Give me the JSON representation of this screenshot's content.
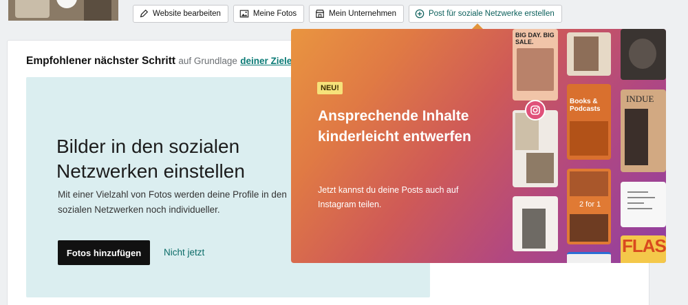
{
  "toolbar": {
    "buttons": [
      {
        "label": "Website bearbeiten",
        "icon": "pencil-icon"
      },
      {
        "label": "Meine Fotos",
        "icon": "image-icon"
      },
      {
        "label": "Mein Unternehmen",
        "icon": "storefront-icon"
      },
      {
        "label": "Post für soziale Netzwerke erstellen",
        "icon": "plus-circle-icon"
      }
    ]
  },
  "recommendation": {
    "title": "Empfohlener nächster Schritt",
    "subtitle": "auf Grundlage",
    "link": "deiner Ziele"
  },
  "panel": {
    "heading": "Bilder in den sozialen Netzwerken einstellen",
    "description": "Mit einer Vielzahl von Fotos werden deine Profile in den sozialen Netzwerken noch individueller.",
    "primary_button": "Fotos hinzufügen",
    "secondary_link": "Nicht jetzt"
  },
  "promo": {
    "badge": "NEU!",
    "heading": "Ansprechende Inhalte kinderleicht entwerfen",
    "description": "Jetzt kannst du deine Posts auch auf Instagram teilen.",
    "tiles": {
      "big_day": "BIG DAY. BIG SALE.",
      "books": "Books & Podcasts",
      "two_for_one": "2 for 1",
      "indue": "INDUE",
      "flash": "FLASH"
    }
  },
  "colors": {
    "accent": "#0a7a75",
    "primary_button": "#111111",
    "panel_bg": "#dbeef0",
    "badge": "#f6e27a"
  }
}
